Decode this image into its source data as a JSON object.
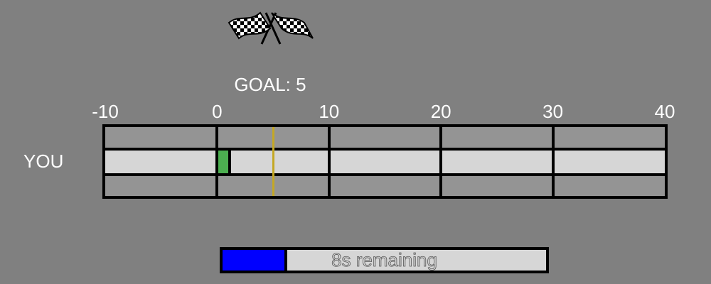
{
  "goal": {
    "label": "GOAL: 5",
    "value": 5
  },
  "axis": {
    "min": -10,
    "max": 40,
    "ticks": [
      {
        "value": -10,
        "label": "-10"
      },
      {
        "value": 0,
        "label": "0"
      },
      {
        "value": 10,
        "label": "10"
      },
      {
        "value": 20,
        "label": "20"
      },
      {
        "value": 30,
        "label": "30"
      },
      {
        "value": 40,
        "label": "40"
      }
    ]
  },
  "player": {
    "label": "YOU",
    "position": 1
  },
  "timer": {
    "text": "8s remaining",
    "fraction": 0.2
  },
  "icons": {
    "finish": "checkered-flags-icon"
  },
  "colors": {
    "background": "#808080",
    "player": "#4caf50",
    "goal_line": "#c4a824",
    "timer_fill": "#0000ff"
  }
}
